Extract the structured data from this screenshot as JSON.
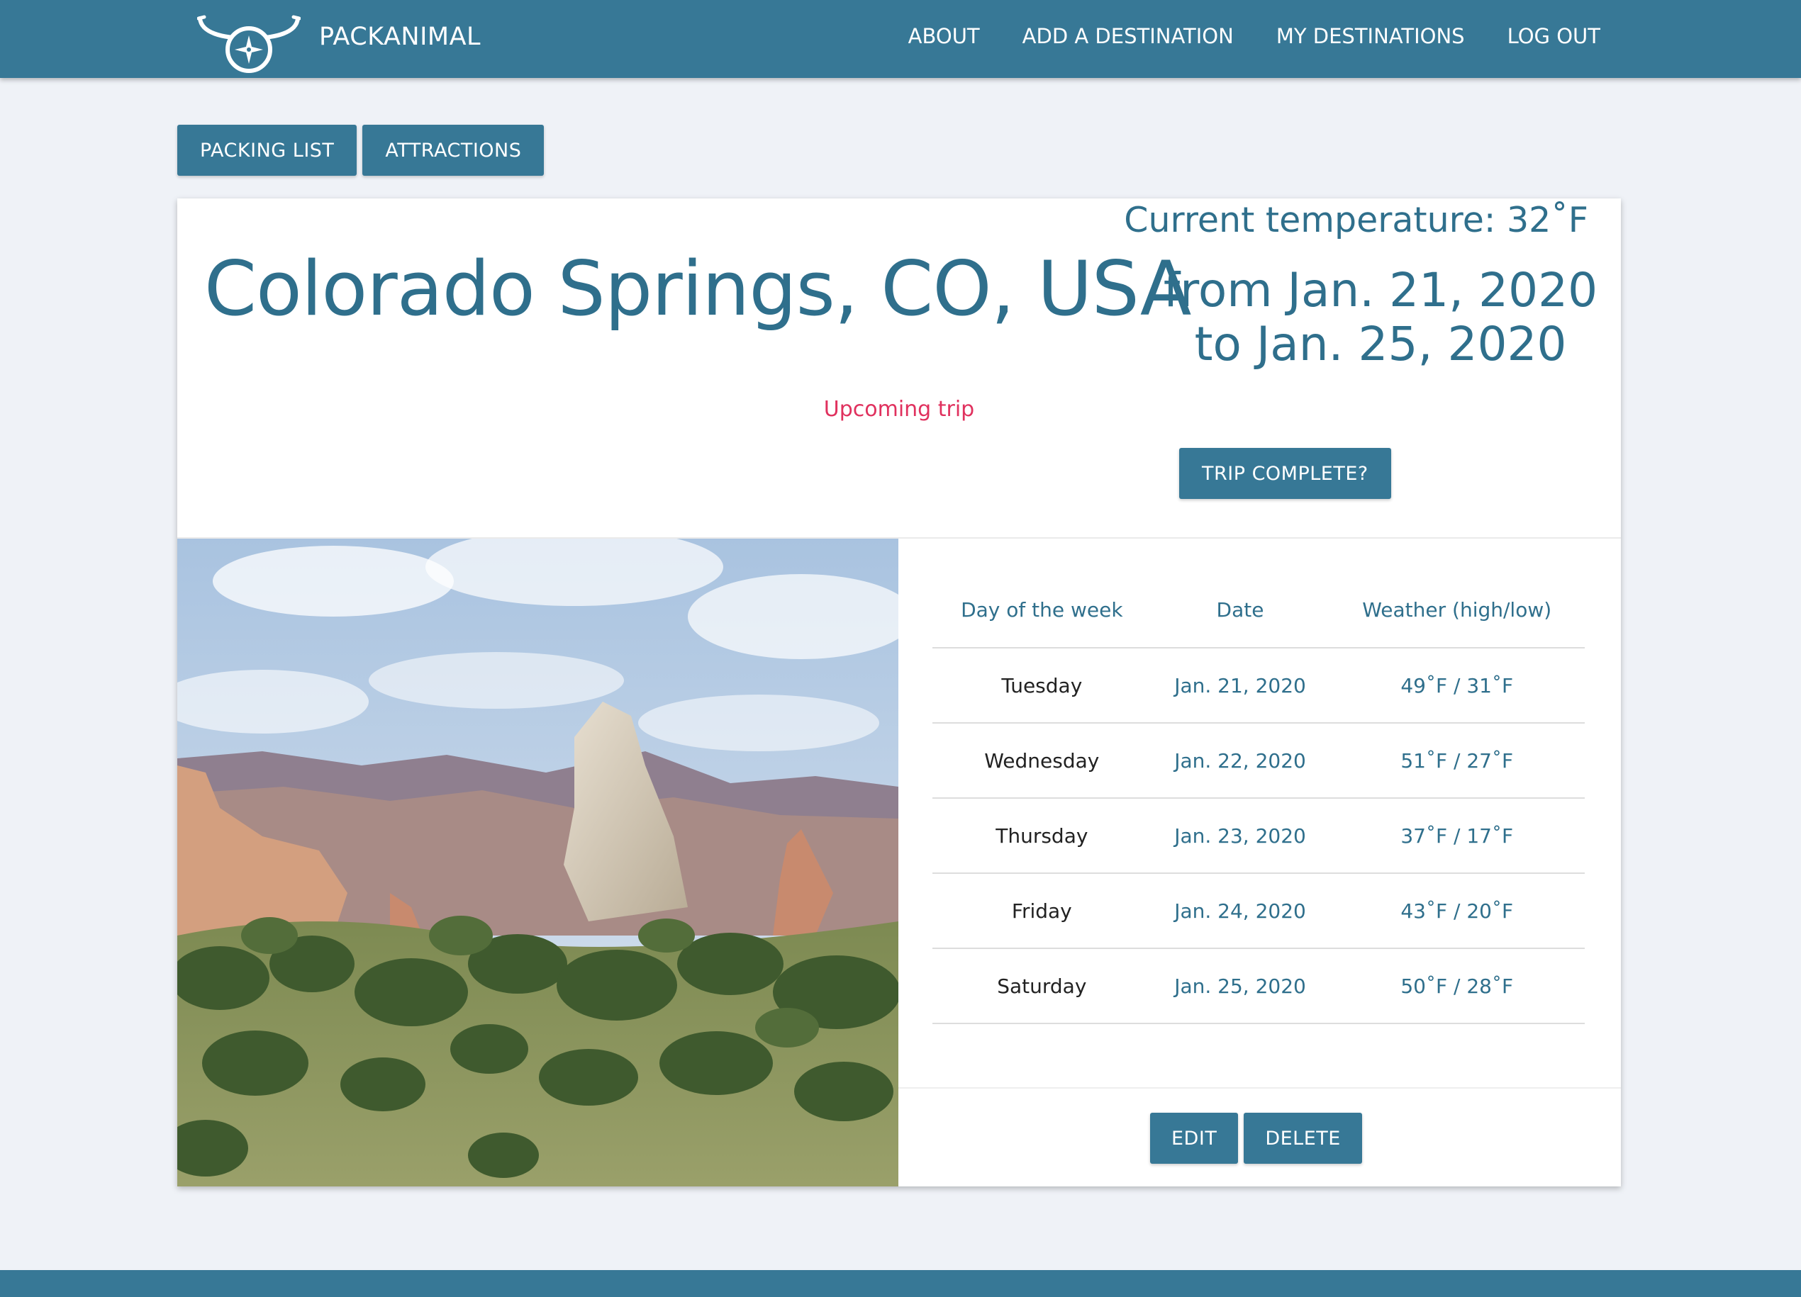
{
  "brand": {
    "name": "PACKANIMAL",
    "logo_icon": "bull-horns-compass-logo"
  },
  "nav": {
    "links": [
      "ABOUT",
      "ADD A DESTINATION",
      "MY DESTINATIONS",
      "LOG OUT"
    ]
  },
  "tabs": [
    "PACKING LIST",
    "ATTRACTIONS"
  ],
  "trip": {
    "current_temperature": "Current temperature: 32˚F",
    "city": "Colorado Springs, CO, USA",
    "date_range": "from Jan. 21, 2020 to Jan. 25, 2020",
    "status": "Upcoming trip",
    "complete_button": "TRIP COMPLETE?"
  },
  "weather_table": {
    "headers": [
      "Day of the week",
      "Date",
      "Weather (high/low)"
    ],
    "rows": [
      {
        "day": "Tuesday",
        "date": "Jan. 21, 2020",
        "weather": "49˚F / 31˚F"
      },
      {
        "day": "Wednesday",
        "date": "Jan. 22, 2020",
        "weather": "51˚F / 27˚F"
      },
      {
        "day": "Thursday",
        "date": "Jan. 23, 2020",
        "weather": "37˚F / 17˚F"
      },
      {
        "day": "Friday",
        "date": "Jan. 24, 2020",
        "weather": "43˚F / 20˚F"
      },
      {
        "day": "Saturday",
        "date": "Jan. 25, 2020",
        "weather": "50˚F / 28˚F"
      }
    ]
  },
  "actions": {
    "edit": "EDIT",
    "delete": "DELETE"
  },
  "colors": {
    "primary": "#377896",
    "heading_text": "#2f6f8c",
    "status_text": "#e0315e",
    "page_background": "#eff2f7"
  }
}
